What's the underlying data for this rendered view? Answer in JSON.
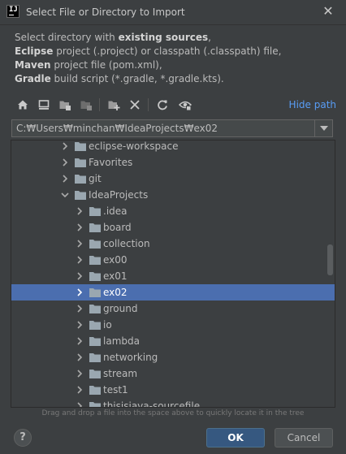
{
  "window": {
    "title": "Select File or Directory to Import",
    "close_glyph": "✕"
  },
  "description": {
    "line1_a": "Select directory with ",
    "line1_b": "existing sources",
    "line1_c": ",",
    "line2_a": "Eclipse",
    "line2_b": " project (.project) or classpath (.classpath) file,",
    "line3_a": "Maven",
    "line3_b": " project file (pom.xml),",
    "line4_a": "Gradle",
    "line4_b": " build script (*.gradle, *.gradle.kts)."
  },
  "toolbar": {
    "icons": [
      "home-icon",
      "desktop-icon",
      "project-folder-icon",
      "module-folder-icon",
      "new-folder-icon",
      "delete-icon",
      "refresh-icon",
      "show-hidden-icon"
    ],
    "hide_path_label": "Hide path"
  },
  "path": {
    "value": "C:₩Users₩minchan₩IdeaProjects₩ex02"
  },
  "tree": {
    "rows": [
      {
        "label": "eclipse-workspace"
      },
      {
        "label": "Favorites"
      },
      {
        "label": "git"
      },
      {
        "label": "IdeaProjects"
      },
      {
        "label": ".idea"
      },
      {
        "label": "board"
      },
      {
        "label": "collection"
      },
      {
        "label": "ex00"
      },
      {
        "label": "ex01"
      },
      {
        "label": "ex02"
      },
      {
        "label": "ground"
      },
      {
        "label": "io"
      },
      {
        "label": "lambda"
      },
      {
        "label": "networking"
      },
      {
        "label": "stream"
      },
      {
        "label": "test1"
      },
      {
        "label": "thisisjava-sourcefile"
      }
    ]
  },
  "hint": "Drag and drop a file into the space above to quickly locate it in the tree",
  "footer": {
    "help": "?",
    "ok": "OK",
    "cancel": "Cancel"
  }
}
